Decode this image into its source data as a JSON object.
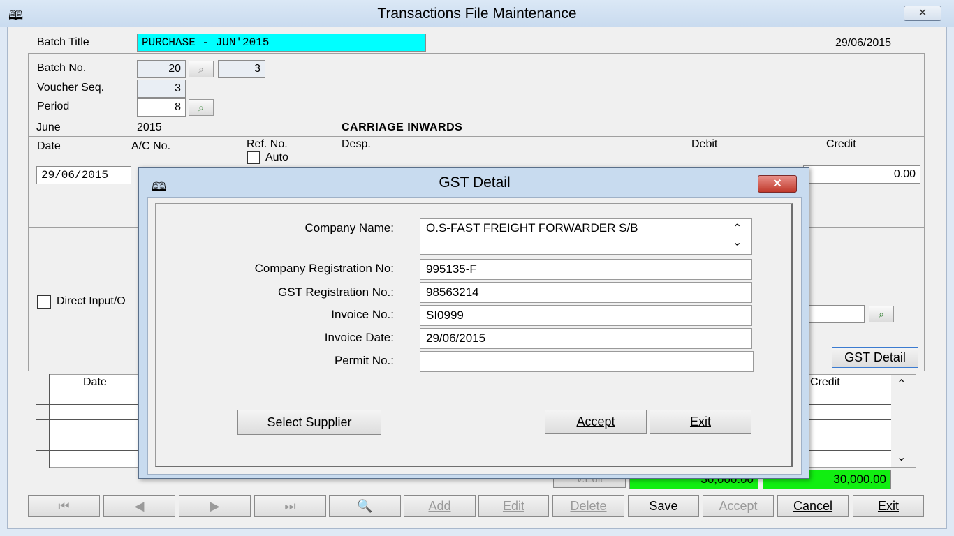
{
  "window": {
    "title": "Transactions File Maintenance",
    "close_label": "✕"
  },
  "header": {
    "batch_title_label": "Batch Title",
    "batch_title_value": "PURCHASE - JUN'2015",
    "date": "29/06/2015",
    "batch_no_label": "Batch No.",
    "batch_no_value": "20",
    "batch_no_value2": "3",
    "voucher_seq_label": "Voucher Seq.",
    "voucher_seq_value": "3",
    "period_label": "Period",
    "period_value": "8",
    "month": "June",
    "year": "2015",
    "account_name": "CARRIAGE INWARDS"
  },
  "entry": {
    "col_date": "Date",
    "col_ac_no": "A/C No.",
    "col_ref_no": "Ref. No.",
    "auto_label": "Auto",
    "col_desp": "Desp.",
    "col_debit": "Debit",
    "col_credit": "Credit",
    "date_value": "29/06/2015",
    "credit_value": "0.00",
    "direct_input_label": "Direct Input/O",
    "gst_detail_button": "GST Detail"
  },
  "grid": {
    "col_date": "Date",
    "col_credit": "Credit",
    "v_edit_label": "V.Edit",
    "debit_total": "30,000.00",
    "credit_total": "30,000.00"
  },
  "toolbar": {
    "first": "⏮",
    "prev": "◀",
    "next": "▶",
    "last": "⏭",
    "find": "🔍",
    "add": "Add",
    "edit": "Edit",
    "delete": "Delete",
    "save": "Save",
    "accept": "Accept",
    "cancel": "Cancel",
    "exit": "Exit"
  },
  "dialog": {
    "title": "GST Detail",
    "close_label": "✕",
    "company_name_label": "Company Name:",
    "company_name_value": "O.S-FAST FREIGHT FORWARDER S/B",
    "company_reg_label": "Company Registration No:",
    "company_reg_value": "995135-F",
    "gst_reg_label": "GST Registration No.:",
    "gst_reg_value": "98563214",
    "invoice_no_label": "Invoice No.:",
    "invoice_no_value": "SI0999",
    "invoice_date_label": "Invoice Date:",
    "invoice_date_value": "29/06/2015",
    "permit_no_label": "Permit No.:",
    "permit_no_value": "",
    "select_supplier_button": "Select Supplier",
    "accept_button": "Accept",
    "exit_button": "Exit"
  },
  "colors": {
    "batch_title_bg": "#00ffff",
    "totals_bg": "#11ee11",
    "dialog_close_bg": "#c0392b"
  }
}
